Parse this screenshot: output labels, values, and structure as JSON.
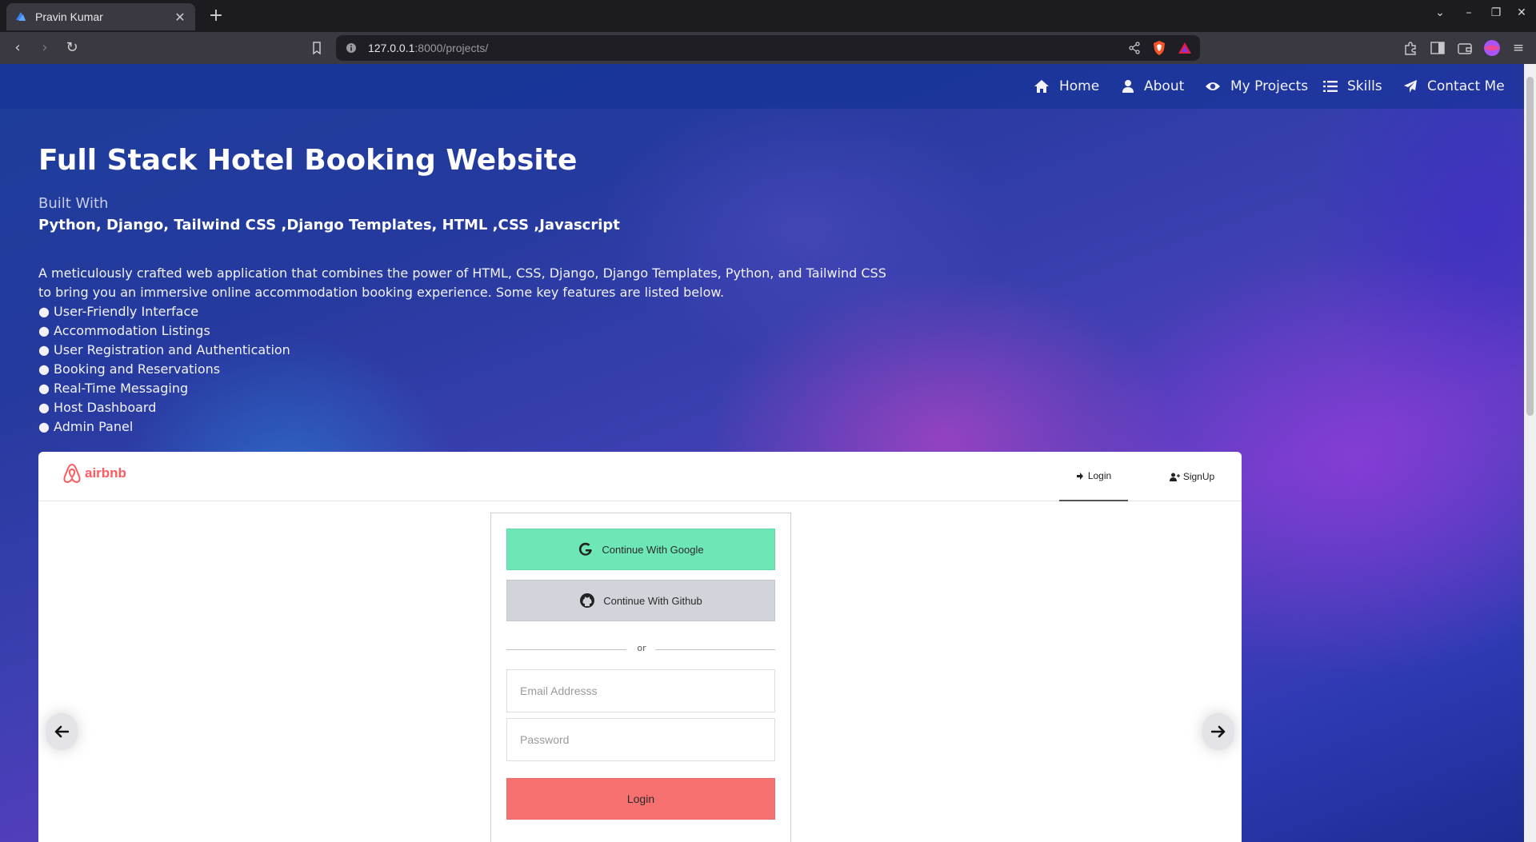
{
  "browser": {
    "tab_title": "Pravin Kumar",
    "url_host": "127.0.0.1",
    "url_path": ":8000/projects/"
  },
  "nav": {
    "items": [
      {
        "label": "Home",
        "icon": "home-icon"
      },
      {
        "label": "About",
        "icon": "user-icon"
      },
      {
        "label": "My Projects",
        "icon": "eye-icon"
      },
      {
        "label": "Skills",
        "icon": "list-icon"
      },
      {
        "label": "Contact Me",
        "icon": "paper-plane-icon"
      }
    ]
  },
  "project": {
    "title": "Full Stack Hotel Booking Website",
    "built_with_label": "Built With",
    "built_with": "Python, Django, Tailwind CSS ,Django Templates, HTML ,CSS ,Javascript",
    "description": "A meticulously crafted web application that combines the power of HTML, CSS, Django, Django Templates, Python, and Tailwind CSS to bring you an immersive online accommodation booking experience. Some key features are listed below.",
    "features": [
      "● User-Friendly Interface",
      "● Accommodation Listings",
      "● User Registration and Authentication",
      "● Booking and Reservations",
      "● Real-Time Messaging",
      "● Host Dashboard",
      "● Admin Panel"
    ]
  },
  "preview": {
    "logo_text": "airbnb",
    "tabs": {
      "login": "Login",
      "signup": "SignUp"
    },
    "google_button": "Continue With Google",
    "github_button": "Continue With Github",
    "divider_text": "or",
    "email_placeholder": "Email Addresss",
    "password_placeholder": "Password",
    "login_button": "Login"
  },
  "colors": {
    "nav_bg": "#1e3a8a",
    "google_green": "#6ee7b7",
    "github_gray": "#d1d5db",
    "login_red": "#f87171",
    "airbnb_red": "#ff5a5f"
  }
}
